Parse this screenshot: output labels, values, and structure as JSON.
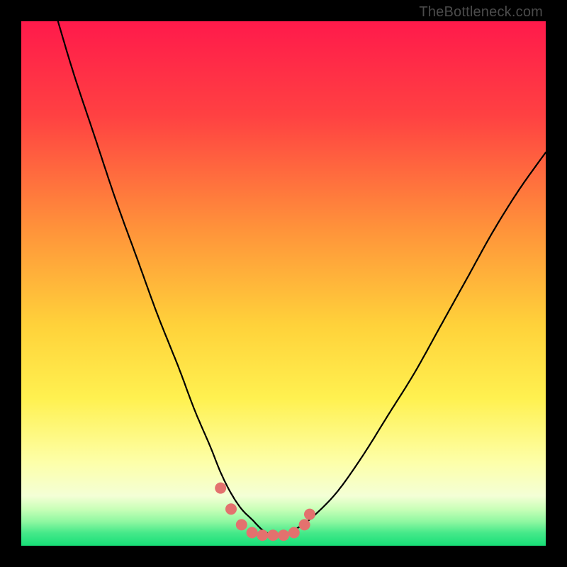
{
  "watermark": "TheBottleneck.com",
  "chart_data": {
    "type": "line",
    "title": "",
    "xlabel": "",
    "ylabel": "",
    "xlim": [
      0,
      100
    ],
    "ylim": [
      0,
      100
    ],
    "series": [
      {
        "name": "curve",
        "x": [
          7,
          10,
          14,
          18,
          22,
          26,
          30,
          33,
          36,
          38,
          40,
          42,
          44,
          46,
          48,
          50,
          52,
          55,
          60,
          65,
          70,
          75,
          80,
          85,
          90,
          95,
          100
        ],
        "y": [
          100,
          90,
          78,
          66,
          55,
          44,
          34,
          26,
          19,
          14,
          10,
          7,
          5,
          3,
          2,
          2,
          3,
          5,
          10,
          17,
          25,
          33,
          42,
          51,
          60,
          68,
          75
        ]
      }
    ],
    "markers": {
      "name": "highlight-dots",
      "color": "#e3716e",
      "x": [
        38,
        40,
        42,
        44,
        46,
        48,
        50,
        52,
        54,
        55
      ],
      "y": [
        11,
        7,
        4,
        2.5,
        2,
        2,
        2,
        2.5,
        4,
        6
      ]
    },
    "gradient_stops": [
      {
        "pos": 0.0,
        "color": "#ff1a4b"
      },
      {
        "pos": 0.18,
        "color": "#ff4142"
      },
      {
        "pos": 0.4,
        "color": "#ff943a"
      },
      {
        "pos": 0.58,
        "color": "#ffd23a"
      },
      {
        "pos": 0.72,
        "color": "#fff150"
      },
      {
        "pos": 0.84,
        "color": "#fdffa8"
      },
      {
        "pos": 0.905,
        "color": "#f4ffd6"
      },
      {
        "pos": 0.93,
        "color": "#c9ffb8"
      },
      {
        "pos": 0.955,
        "color": "#8cf7a0"
      },
      {
        "pos": 0.975,
        "color": "#47e98a"
      },
      {
        "pos": 1.0,
        "color": "#17df77"
      }
    ]
  }
}
